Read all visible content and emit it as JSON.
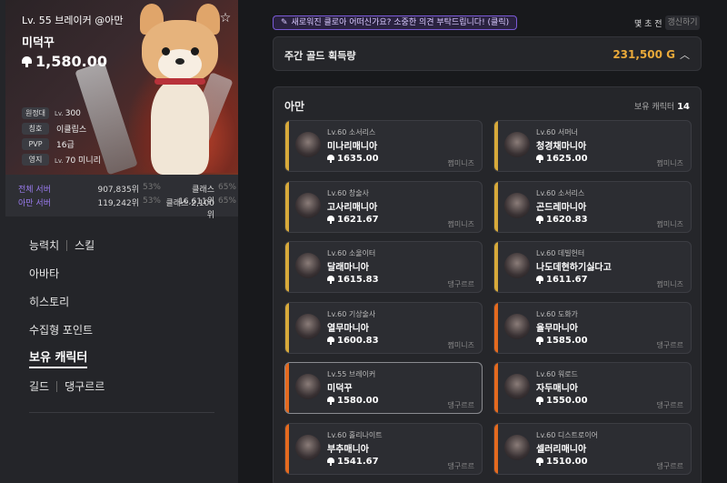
{
  "profile": {
    "title": "Lv. 55 브레이커 @아만",
    "name": "미덕꾸",
    "item_level": "1,580.00",
    "info": [
      {
        "label": "원정대",
        "prefix": "Lv.",
        "value": "300"
      },
      {
        "label": "칭호",
        "prefix": "",
        "value": "이클립스"
      },
      {
        "label": "PVP",
        "prefix": "",
        "value": "16급"
      },
      {
        "label": "영지",
        "prefix": "Lv.",
        "value": "70 미니리"
      }
    ]
  },
  "ranking": [
    {
      "label": "전체 서버",
      "rank": "907,835위",
      "pct": "53%",
      "class_rank": "클래스 16,611위",
      "class_pct": "65%"
    },
    {
      "label": "아만 서버",
      "rank": "119,242위",
      "pct": "53%",
      "class_rank": "클래스 2,100위",
      "class_pct": "65%"
    }
  ],
  "nav": {
    "ability": "능력치",
    "skill": "스킬",
    "avatar": "아바타",
    "history": "히스토리",
    "collectibles": "수집형 포인트",
    "characters": "보유 캐릭터",
    "guild": "길드",
    "guild_name": "댕구르르"
  },
  "notice": "새로워진 클로아 어떠신가요? 소중한 의견 부탁드립니다! (클릭)",
  "updated": "몇 초 전",
  "refresh": "갱신하기",
  "gold": {
    "label": "주간 골드 획득량",
    "value": "231,500 G"
  },
  "server": {
    "name": "아만",
    "owned_label": "보유 캐릭터",
    "owned_count": "14"
  },
  "colors": {
    "accent": "#e9a93a",
    "orange": "#e46a1f",
    "purple": "#9b7cf0"
  },
  "characters": [
    {
      "cls": "Lv.60 소서리스",
      "name": "미나리매니아",
      "level": "1635.00",
      "group": "쩜미니즈",
      "bar": "#d7a93a"
    },
    {
      "cls": "Lv.60 서머너",
      "name": "청경채마니아",
      "level": "1625.00",
      "group": "쩜미니즈",
      "bar": "#d7a93a"
    },
    {
      "cls": "Lv.60 창술사",
      "name": "고사리매니아",
      "level": "1621.67",
      "group": "쩜미니즈",
      "bar": "#d7a93a"
    },
    {
      "cls": "Lv.60 소서리스",
      "name": "곤드레마니아",
      "level": "1620.83",
      "group": "쩜미니즈",
      "bar": "#d7a93a"
    },
    {
      "cls": "Lv.60 소울이터",
      "name": "달래마니아",
      "level": "1615.83",
      "group": "댕구르르",
      "bar": "#d7a93a"
    },
    {
      "cls": "Lv.60 데빌헌터",
      "name": "나도데현하기싫다고",
      "level": "1611.67",
      "group": "쩜미니즈",
      "bar": "#d7a93a"
    },
    {
      "cls": "Lv.60 기상술사",
      "name": "열무마니아",
      "level": "1600.83",
      "group": "쩜미니즈",
      "bar": "#d7a93a"
    },
    {
      "cls": "Lv.60 도화가",
      "name": "율무마니아",
      "level": "1585.00",
      "group": "댕구르르",
      "bar": "#e46a1f"
    },
    {
      "cls": "Lv.55 브레이커",
      "name": "미덕꾸",
      "level": "1580.00",
      "group": "댕구르르",
      "bar": "#e46a1f"
    },
    {
      "cls": "Lv.60 워로드",
      "name": "자두매니아",
      "level": "1550.00",
      "group": "댕구르르",
      "bar": "#e46a1f"
    },
    {
      "cls": "Lv.60 홀리나이트",
      "name": "부추매니아",
      "level": "1541.67",
      "group": "댕구르르",
      "bar": "#e46a1f"
    },
    {
      "cls": "Lv.60 디스트로이어",
      "name": "셀러리매니아",
      "level": "1510.00",
      "group": "댕구르르",
      "bar": "#e46a1f"
    }
  ]
}
